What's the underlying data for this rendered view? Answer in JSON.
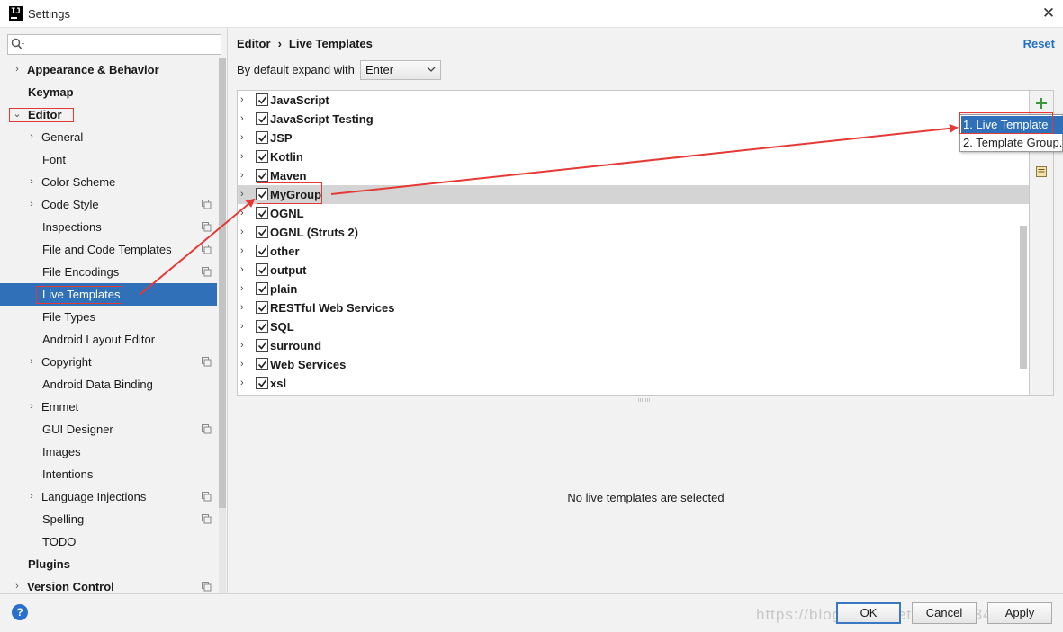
{
  "window": {
    "title": "Settings"
  },
  "search": {
    "placeholder": ""
  },
  "sidebar": {
    "items": [
      {
        "label": "Appearance & Behavior"
      },
      {
        "label": "Keymap"
      },
      {
        "label": "Editor"
      },
      {
        "label": "General"
      },
      {
        "label": "Font"
      },
      {
        "label": "Color Scheme"
      },
      {
        "label": "Code Style"
      },
      {
        "label": "Inspections"
      },
      {
        "label": "File and Code Templates"
      },
      {
        "label": "File Encodings"
      },
      {
        "label": "Live Templates"
      },
      {
        "label": "File Types"
      },
      {
        "label": "Android Layout Editor"
      },
      {
        "label": "Copyright"
      },
      {
        "label": "Android Data Binding"
      },
      {
        "label": "Emmet"
      },
      {
        "label": "GUI Designer"
      },
      {
        "label": "Images"
      },
      {
        "label": "Intentions"
      },
      {
        "label": "Language Injections"
      },
      {
        "label": "Spelling"
      },
      {
        "label": "TODO"
      },
      {
        "label": "Plugins"
      },
      {
        "label": "Version Control"
      }
    ]
  },
  "breadcrumb": {
    "parent": "Editor",
    "separator": "›",
    "current": "Live Templates"
  },
  "reset_label": "Reset",
  "expand": {
    "label": "By default expand with",
    "value": "Enter"
  },
  "templates": [
    {
      "label": "JavaScript"
    },
    {
      "label": "JavaScript Testing"
    },
    {
      "label": "JSP"
    },
    {
      "label": "Kotlin"
    },
    {
      "label": "Maven"
    },
    {
      "label": "MyGroup"
    },
    {
      "label": "OGNL"
    },
    {
      "label": "OGNL (Struts 2)"
    },
    {
      "label": "other"
    },
    {
      "label": "output"
    },
    {
      "label": "plain"
    },
    {
      "label": "RESTful Web Services"
    },
    {
      "label": "SQL"
    },
    {
      "label": "surround"
    },
    {
      "label": "Web Services"
    },
    {
      "label": "xsl"
    }
  ],
  "empty_message": "No live templates are selected",
  "popup": {
    "items": [
      {
        "label": "1. Live Template"
      },
      {
        "label": "2. Template Group..."
      }
    ]
  },
  "buttons": {
    "ok": "OK",
    "cancel": "Cancel",
    "apply": "Apply"
  },
  "help_label": "?",
  "watermark": "https://blog.csdn.net/qq_38234766",
  "colors": {
    "selection": "#2f70b8",
    "annotation": "#e53935",
    "link": "#2470c4",
    "add_icon": "#3a9a3a"
  }
}
